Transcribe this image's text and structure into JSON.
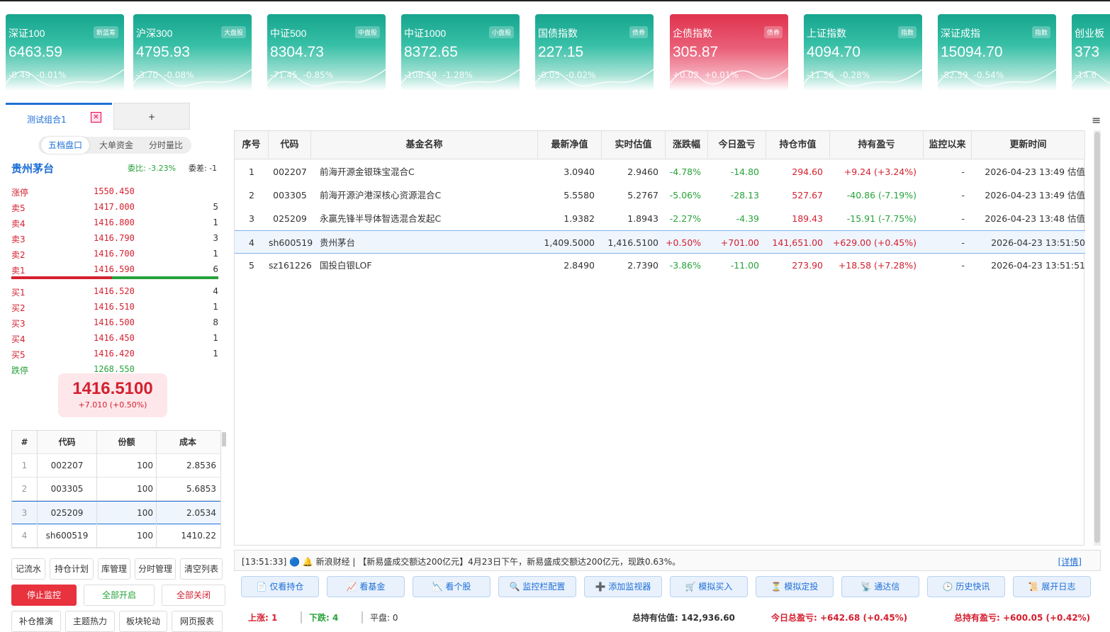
{
  "indices": [
    {
      "name": "深证100",
      "tag": "新蓝筹",
      "value": "6463.59",
      "change": "-0.49",
      "pct": "-0.01%",
      "trend": "down"
    },
    {
      "name": "沪深300",
      "tag": "大盘股",
      "value": "4795.93",
      "change": "-3.70",
      "pct": "-0.08%",
      "trend": "down"
    },
    {
      "name": "中证500",
      "tag": "中盘股",
      "value": "8304.73",
      "change": "-71.45",
      "pct": "-0.85%",
      "trend": "down"
    },
    {
      "name": "中证1000",
      "tag": "小盘股",
      "value": "8372.65",
      "change": "-108.59",
      "pct": "-1.28%",
      "trend": "down"
    },
    {
      "name": "国债指数",
      "tag": "债券",
      "value": "227.15",
      "change": "-0.05",
      "pct": "-0.02%",
      "trend": "down"
    },
    {
      "name": "企债指数",
      "tag": "债券",
      "value": "305.87",
      "change": "+0.02",
      "pct": "+0.01%",
      "trend": "up"
    },
    {
      "name": "上证指数",
      "tag": "指数",
      "value": "4094.70",
      "change": "-11.56",
      "pct": "-0.28%",
      "trend": "down"
    },
    {
      "name": "深证成指",
      "tag": "指数",
      "value": "15094.70",
      "change": "-82.59",
      "pct": "-0.54%",
      "trend": "down"
    },
    {
      "name": "创业板",
      "tag": "",
      "value": "373",
      "change": "-14.6",
      "pct": "",
      "trend": "down"
    }
  ],
  "tabs": {
    "active": "测试组合1",
    "close": "✕",
    "add": "+",
    "menu": "≡"
  },
  "panel": {
    "segments": [
      "五档盘口",
      "大单资金",
      "分时量比"
    ],
    "stock": "贵州茅台",
    "weibi": "委比: -3.23%",
    "weicha": "委差: -1",
    "book": [
      {
        "label": "涨停",
        "price": "1550.450",
        "vol": "",
        "cls": "redl"
      },
      {
        "label": "卖5",
        "price": "1417.000",
        "vol": "5",
        "cls": "redl"
      },
      {
        "label": "卖4",
        "price": "1416.800",
        "vol": "1",
        "cls": "redl"
      },
      {
        "label": "卖3",
        "price": "1416.790",
        "vol": "3",
        "cls": "redl"
      },
      {
        "label": "卖2",
        "price": "1416.700",
        "vol": "1",
        "cls": "redl"
      },
      {
        "label": "卖1",
        "price": "1416.590",
        "vol": "6",
        "cls": "redl"
      },
      {
        "label": "买1",
        "price": "1416.520",
        "vol": "4",
        "cls": "redl"
      },
      {
        "label": "买2",
        "price": "1416.510",
        "vol": "1",
        "cls": "redl"
      },
      {
        "label": "买3",
        "price": "1416.500",
        "vol": "8",
        "cls": "redl"
      },
      {
        "label": "买4",
        "price": "1416.450",
        "vol": "1",
        "cls": "redl"
      },
      {
        "label": "买5",
        "price": "1416.420",
        "vol": "1",
        "cls": "redl"
      },
      {
        "label": "跌停",
        "price": "1268.550",
        "vol": "",
        "cls": "grn"
      }
    ],
    "price": "1416.5100",
    "price_change": "+7.010  (+0.50%)",
    "pos_headers": [
      "#",
      "代码",
      "份额",
      "成本"
    ],
    "positions": [
      [
        "1",
        "002207",
        "100",
        "2.8536"
      ],
      [
        "2",
        "003305",
        "100",
        "5.6853"
      ],
      [
        "3",
        "025209",
        "100",
        "2.0534"
      ],
      [
        "4",
        "sh600519",
        "100",
        "1410.22"
      ]
    ],
    "buttons1": [
      "记流水",
      "持仓计划",
      "库管理",
      "分时管理",
      "清空列表"
    ],
    "buttons2": [
      "停止监控",
      "全部开启",
      "全部关闭"
    ],
    "buttons3": [
      "补仓推演",
      "主题热力",
      "板块轮动",
      "网页报表"
    ]
  },
  "table": {
    "headers": [
      "序号",
      "代码",
      "基金名称",
      "最新净值",
      "实时估值",
      "涨跌幅",
      "今日盈亏",
      "持仓市值",
      "持有盈亏",
      "监控以来",
      "更新时间"
    ],
    "rows": [
      {
        "c": [
          "1",
          "002207",
          "前海开源金银珠宝混合C",
          "3.0940",
          "2.9460",
          "-4.78%",
          "-14.80",
          "294.60",
          "+9.24 (+3.24%)",
          "-",
          "2026-04-23 13:49 估值"
        ],
        "pct": "grn",
        "today": "grn",
        "hold": "redl"
      },
      {
        "c": [
          "2",
          "003305",
          "前海开源沪港深核心资源混合C",
          "5.5580",
          "5.2767",
          "-5.06%",
          "-28.13",
          "527.67",
          "-40.86 (-7.19%)",
          "-",
          "2026-04-23 13:49 估值"
        ],
        "pct": "grn",
        "today": "grn",
        "hold": "grn"
      },
      {
        "c": [
          "3",
          "025209",
          "永赢先锋半导体智选混合发起C",
          "1.9382",
          "1.8943",
          "-2.27%",
          "-4.39",
          "189.43",
          "-15.91 (-7.75%)",
          "-",
          "2026-04-23 13:48 估值"
        ],
        "pct": "grn",
        "today": "grn",
        "hold": "grn"
      },
      {
        "c": [
          "4",
          "sh600519",
          "贵州茅台",
          "1,409.5000",
          "1,416.5100",
          "+0.50%",
          "+701.00",
          "141,651.00",
          "+629.00 (+0.45%)",
          "-",
          "2026-04-23 13:51:50"
        ],
        "pct": "redl",
        "today": "redl",
        "hold": "redl"
      },
      {
        "c": [
          "5",
          "sz161226",
          "国投白银LOF",
          "2.8490",
          "2.7390",
          "-3.86%",
          "-11.00",
          "273.90",
          "+18.58 (+7.28%)",
          "-",
          "2026-04-23 13:51:51"
        ],
        "pct": "grn",
        "today": "grn",
        "hold": "redl"
      }
    ]
  },
  "news": {
    "text": "[13:51:33] 🔵 🔔 新浪财经 | 【新易盛成交额达200亿元】4月23日下午，新易盛成交额达200亿元，现跌0.63%。",
    "detail": "[详情]"
  },
  "actions": [
    "📄 仅看持仓",
    "📈 看基金",
    "📉 看个股",
    "🔍 监控栏配置",
    "➕ 添加监视器",
    "🛒 模拟买入",
    "⏳ 模拟定投",
    "📡 通达信",
    "🕒 历史快讯",
    "📜 展开日志"
  ],
  "status": {
    "up": "上涨: 1",
    "down": "下跌: 4",
    "flat": "平盘: 0",
    "total": "总持有估值: 142,936.60",
    "today": "今日总盈亏: +642.68 (+0.45%)",
    "hold": "总持有盈亏: +600.05 (+0.42%)"
  },
  "colors": {
    "accent": "#1f6fd6",
    "up": "#d4202f",
    "down": "#27a23a"
  }
}
